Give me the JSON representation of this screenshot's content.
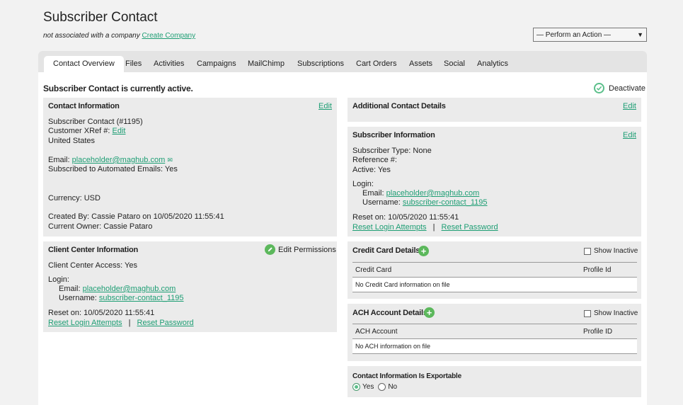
{
  "header": {
    "title": "Subscriber Contact",
    "company_note": "not associated with a company",
    "create_company_link": "Create Company",
    "action_select": "— Perform an Action —"
  },
  "tabs": [
    {
      "label": "Contact Overview",
      "active": true
    },
    {
      "label": "Files"
    },
    {
      "label": "Activities"
    },
    {
      "label": "Campaigns"
    },
    {
      "label": "MailChimp"
    },
    {
      "label": "Subscriptions"
    },
    {
      "label": "Cart Orders"
    },
    {
      "label": "Assets"
    },
    {
      "label": "Social"
    },
    {
      "label": "Analytics"
    }
  ],
  "status": {
    "text": "Subscriber Contact is currently active.",
    "deactivate_label": "Deactivate"
  },
  "contact_info": {
    "title": "Contact Information",
    "edit": "Edit",
    "name_line": "Subscriber Contact (#1195)",
    "xref_label": "Customer XRef #:",
    "xref_edit": "Edit",
    "country": "United States",
    "email_label": "Email:",
    "email": "placeholder@maghub.com",
    "subscribed": "Subscribed to Automated Emails: Yes",
    "currency": "Currency: USD",
    "created_by": "Created By: Cassie Pataro on 10/05/2020 11:55:41",
    "owner": "Current Owner: Cassie Pataro"
  },
  "client_center": {
    "title": "Client Center Information",
    "edit_permissions": "Edit Permissions",
    "access": "Client Center Access: Yes",
    "login_label": "Login:",
    "email_label": "Email:",
    "email": "placeholder@maghub.com",
    "username_label": "Username:",
    "username": "subscriber-contact_1195",
    "reset_on": "Reset on: 10/05/2020 11:55:41",
    "reset_attempts": "Reset Login Attempts",
    "separator": "|",
    "reset_password": "Reset Password"
  },
  "additional": {
    "title": "Additional Contact Details",
    "edit": "Edit"
  },
  "subscriber_info": {
    "title": "Subscriber Information",
    "edit": "Edit",
    "type": "Subscriber Type: None",
    "reference": "Reference #:",
    "active": "Active: Yes",
    "login_label": "Login:",
    "email_label": "Email:",
    "email": "placeholder@maghub.com",
    "username_label": "Username:",
    "username": "subscriber-contact_1195",
    "reset_on": "Reset on: 10/05/2020 11:55:41",
    "reset_attempts": "Reset Login Attempts",
    "separator": "|",
    "reset_password": "Reset Password"
  },
  "credit_card": {
    "title": "Credit Card Details",
    "show_inactive": "Show Inactive",
    "col1": "Credit Card",
    "col2": "Profile Id",
    "empty": "No Credit Card information on file"
  },
  "ach": {
    "title": "ACH Account Details",
    "show_inactive": "Show Inactive",
    "col1": "ACH Account",
    "col2": "Profile ID",
    "empty": "No ACH information on file"
  },
  "exportable": {
    "title": "Contact Information Is Exportable",
    "yes": "Yes",
    "no": "No",
    "selected": "Yes"
  },
  "colors": {
    "accent": "#1e9e74",
    "card_bg": "#ebebeb",
    "add_green": "#5cb85c"
  }
}
